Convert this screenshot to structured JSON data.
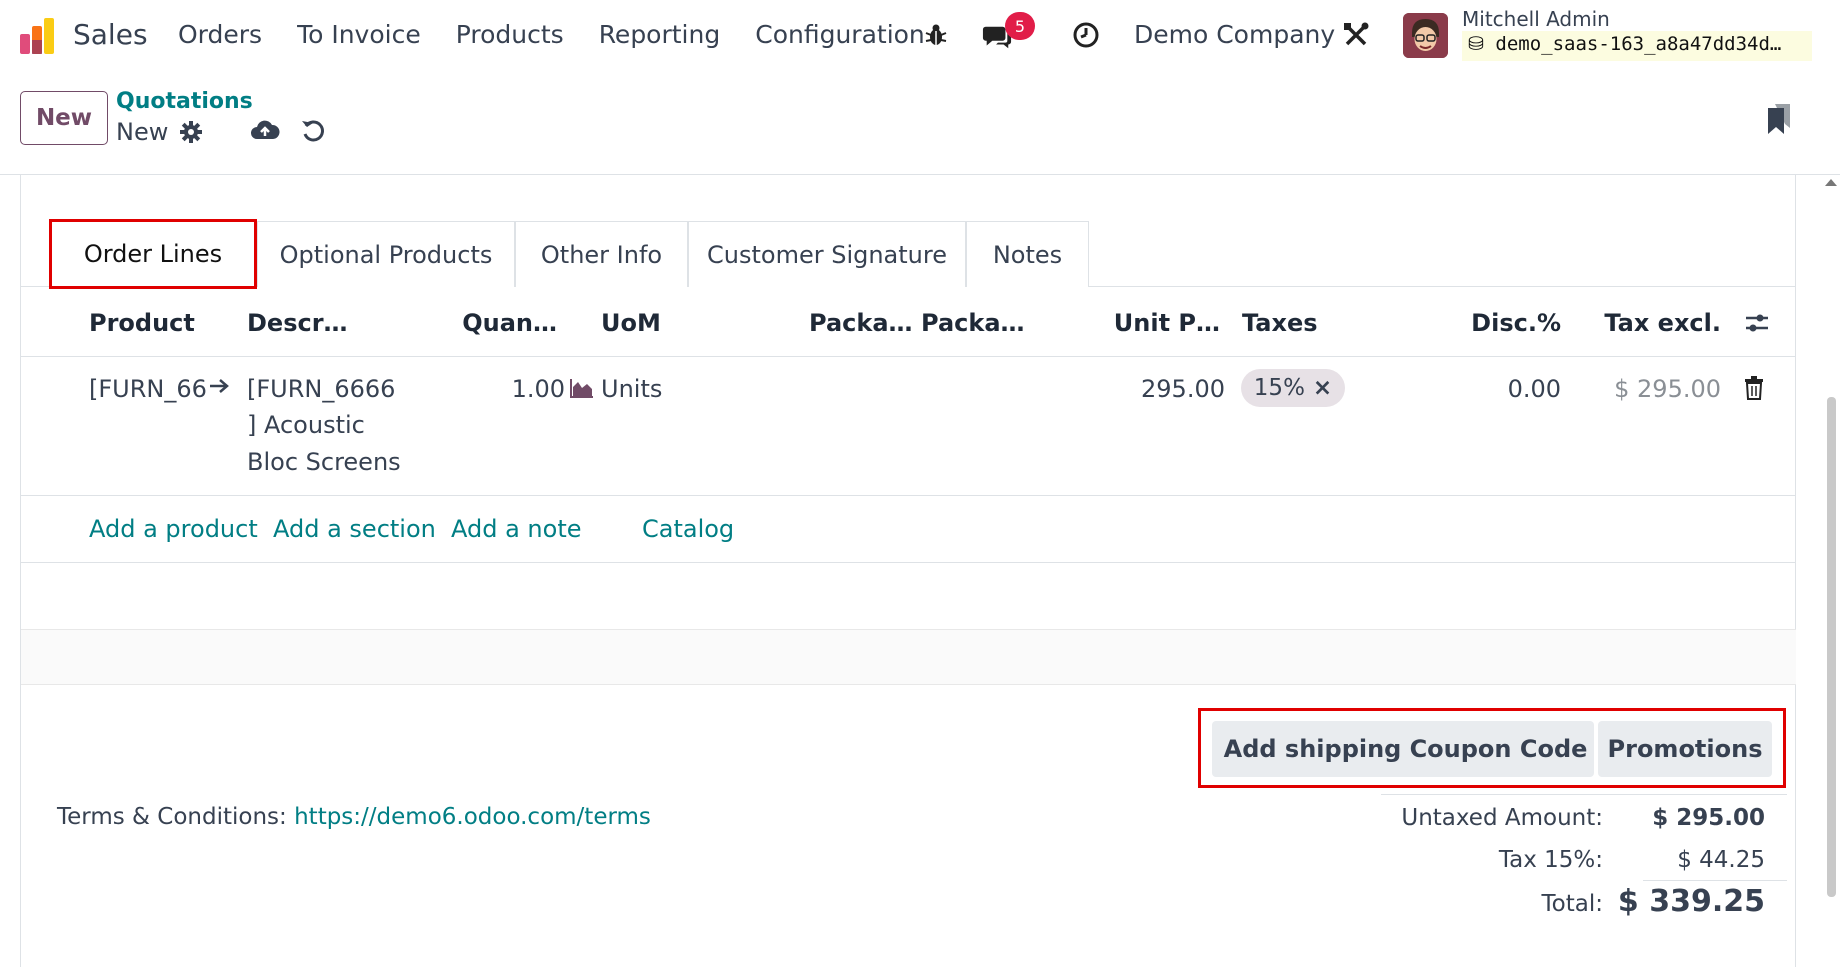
{
  "app": {
    "name": "Sales"
  },
  "menu": [
    "Orders",
    "To Invoice",
    "Products",
    "Reporting",
    "Configuration"
  ],
  "systray": {
    "messages_count": "5",
    "company": "Demo Company",
    "user_name": "Mitchell Admin",
    "database": "demo_saas-163_a8a47dd34d…"
  },
  "control_panel": {
    "new_label": "New",
    "breadcrumb_parent": "Quotations",
    "breadcrumb_current": "New"
  },
  "tabs": [
    "Order Lines",
    "Optional Products",
    "Other Info",
    "Customer Signature",
    "Notes"
  ],
  "table": {
    "headers": {
      "product": "Product",
      "description": "Descr…",
      "quantity": "Quan…",
      "uom": "UoM",
      "packaging_1": "Packa…",
      "packaging_2": "Packa…",
      "unit_price": "Unit P…",
      "taxes": "Taxes",
      "discount": "Disc.%",
      "subtotal": "Tax excl."
    },
    "rows": [
      {
        "product": "[FURN_66",
        "description_lines": [
          "[FURN_6666",
          "] Acoustic",
          "Bloc Screens"
        ],
        "quantity": "1.00",
        "uom": "Units",
        "unit_price": "295.00",
        "tax": "15%",
        "discount": "0.00",
        "subtotal": "$ 295.00"
      }
    ]
  },
  "add_links": {
    "product": "Add a product",
    "section": "Add a section",
    "note": "Add a note",
    "catalog": "Catalog"
  },
  "actions": {
    "shipping": "Add shipping",
    "coupon": "Coupon Code",
    "promotions": "Promotions"
  },
  "terms": {
    "label": "Terms & Conditions:",
    "url": "https://demo6.odoo.com/terms"
  },
  "totals": {
    "untaxed_label": "Untaxed Amount:",
    "untaxed_value": "$ 295.00",
    "tax_label": "Tax 15%:",
    "tax_value": "$ 44.25",
    "total_label": "Total:",
    "total_value": "$ 339.25"
  },
  "colors": {
    "brand": "#714B67",
    "link": "#017e84",
    "highlight": "#e00000",
    "badge": "#e11d48"
  }
}
